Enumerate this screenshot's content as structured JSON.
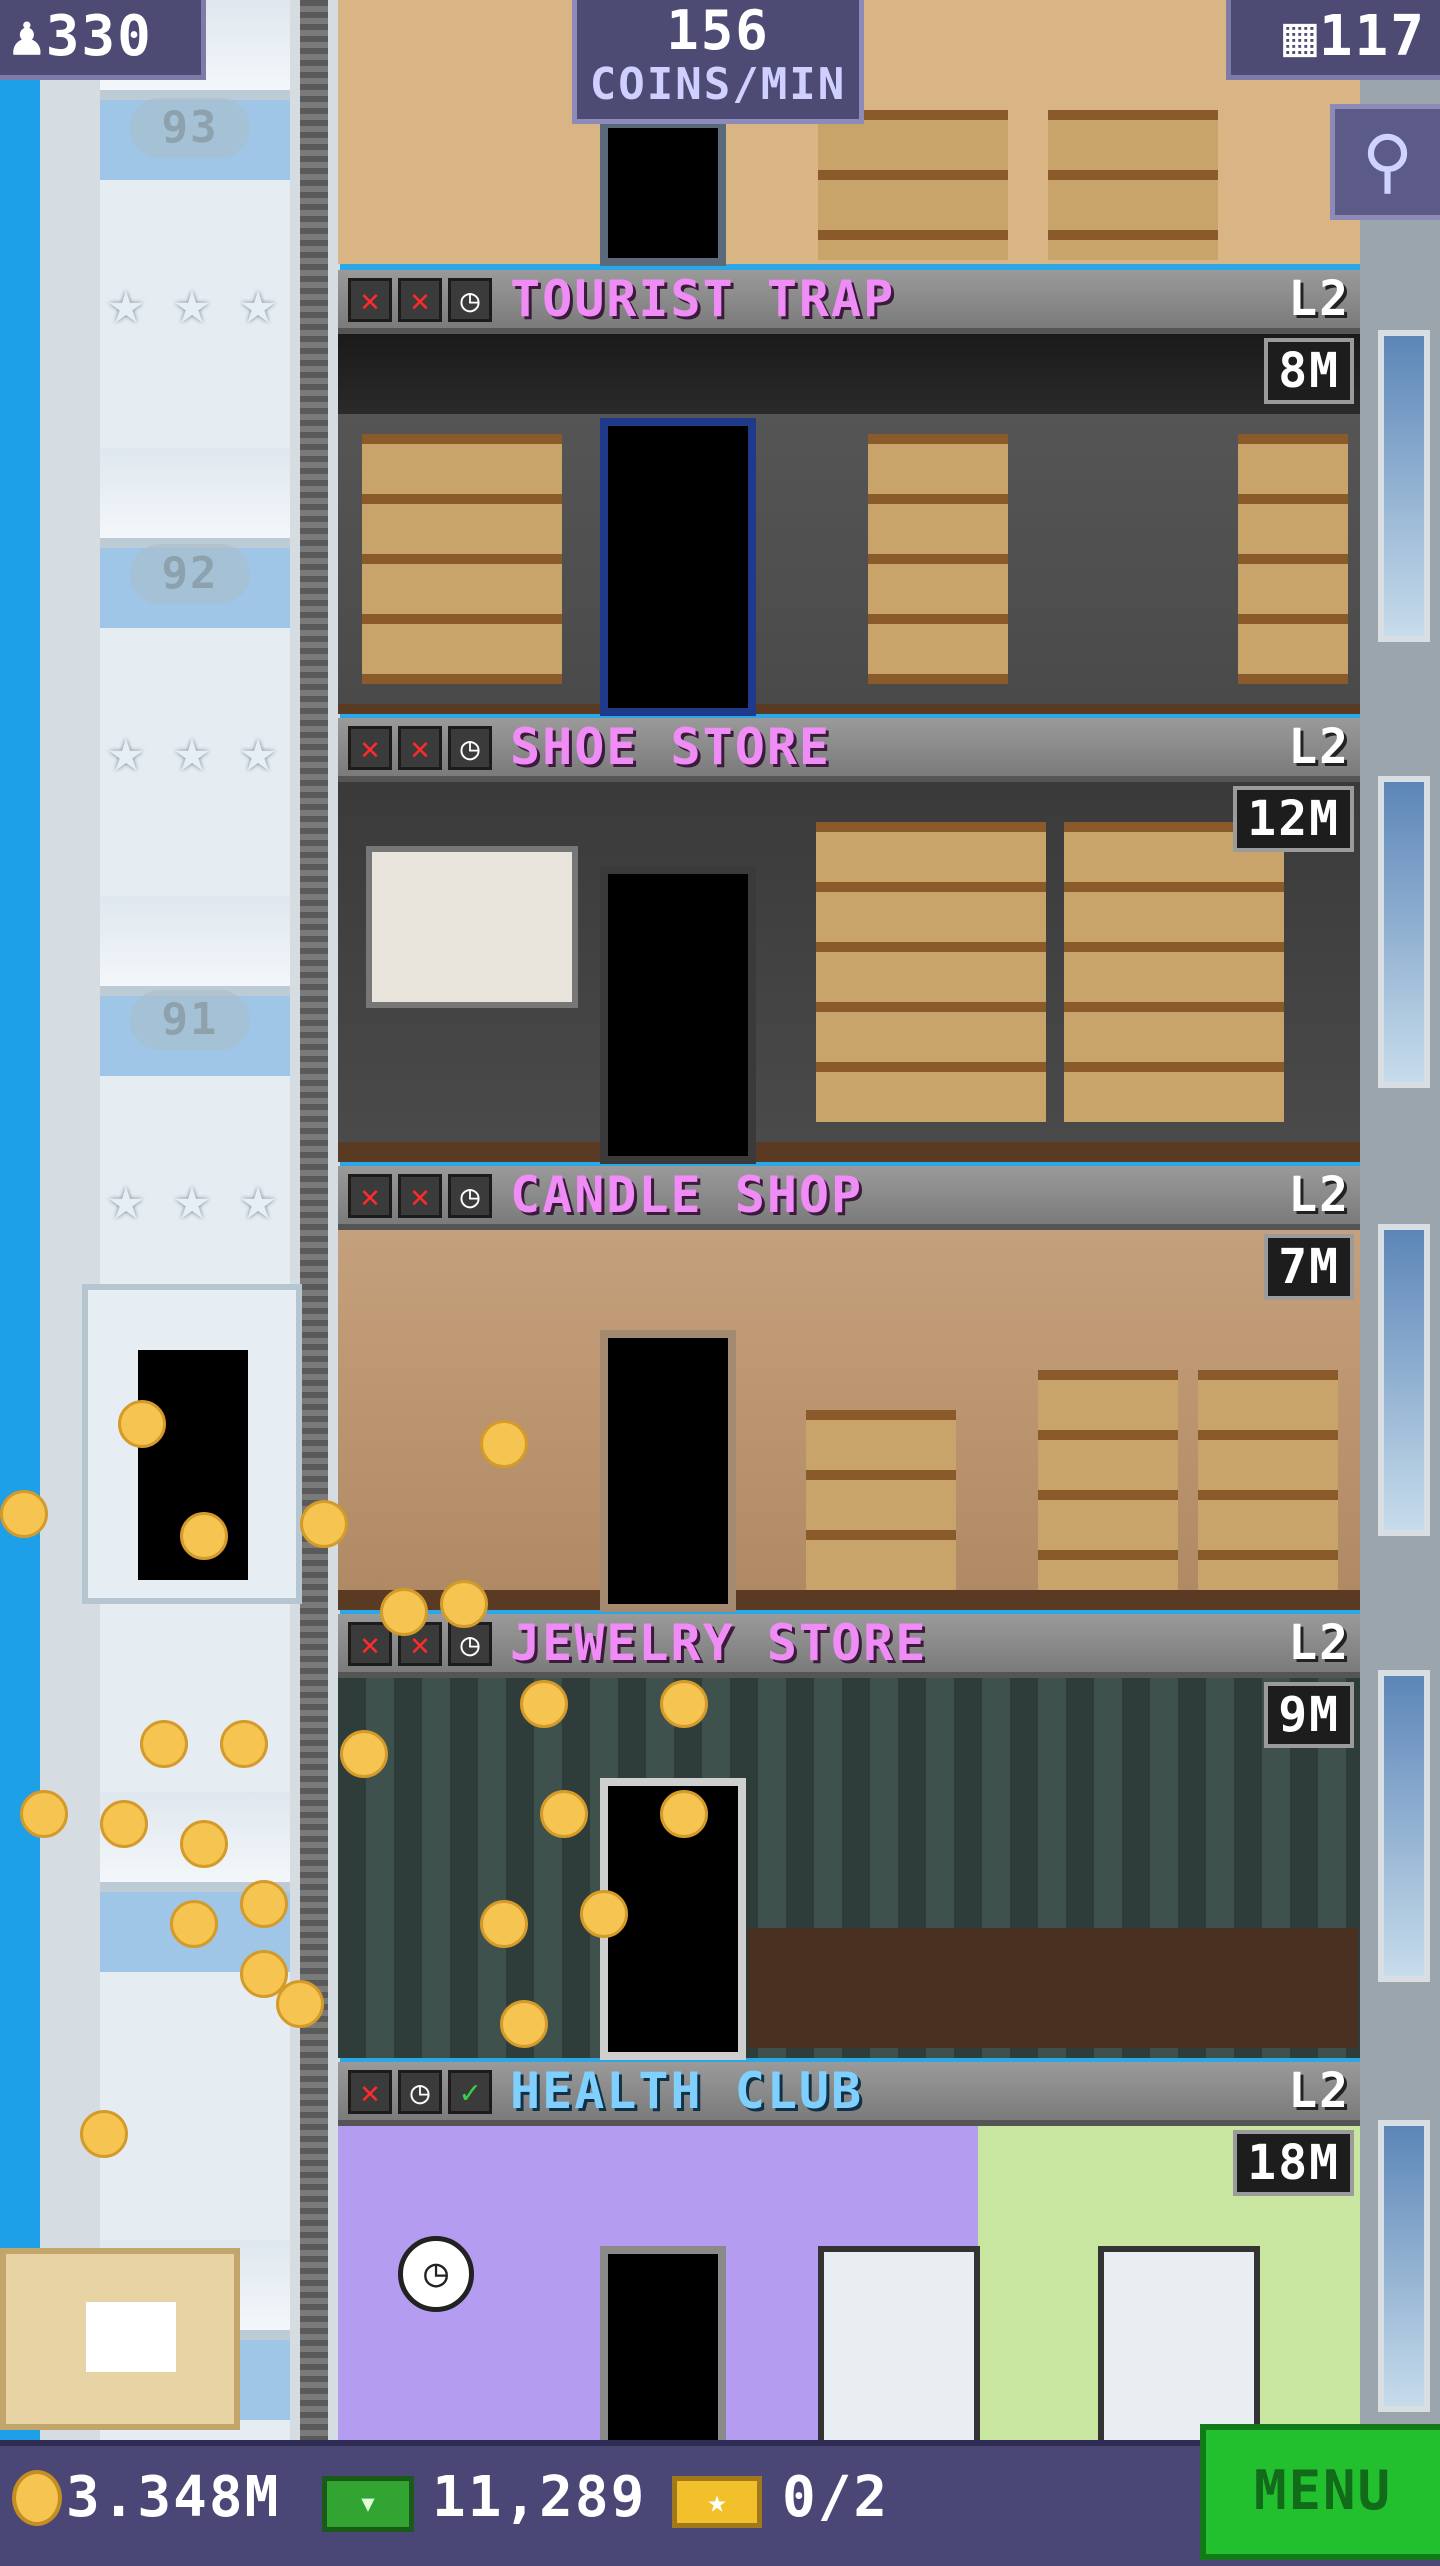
{
  "hud": {
    "population": "330",
    "population_icon": "person-icon",
    "coins_per_min_value": "156",
    "coins_per_min_label": "COINS/MIN",
    "floors_count": "117",
    "floors_icon": "building-icon"
  },
  "elevator": {
    "floor_numbers": [
      "93",
      "92",
      "91"
    ]
  },
  "floors": [
    {
      "name": "TOURIST TRAP",
      "level": "L2",
      "money": "8M",
      "badges": [
        "x",
        "x",
        "clock"
      ],
      "type": "retail"
    },
    {
      "name": "SHOE STORE",
      "level": "L2",
      "money": "12M",
      "badges": [
        "x",
        "x",
        "clock"
      ],
      "type": "retail"
    },
    {
      "name": "CANDLE SHOP",
      "level": "L2",
      "money": "7M",
      "badges": [
        "x",
        "x",
        "clock"
      ],
      "type": "retail"
    },
    {
      "name": "JEWELRY STORE",
      "level": "L2",
      "money": "9M",
      "badges": [
        "x",
        "x",
        "clock"
      ],
      "type": "retail"
    },
    {
      "name": "HEALTH CLUB",
      "level": "L2",
      "money": "18M",
      "badges": [
        "x",
        "clock",
        "check"
      ],
      "type": "service"
    }
  ],
  "bottom_bar": {
    "coins": "3.348M",
    "tower_bux": "11,289",
    "tickets": "0/2",
    "menu_label": "MENU"
  },
  "colors": {
    "retail_name": "#f08cf5",
    "service_name": "#7fd0ff",
    "hud_bg": "#4d4b74",
    "menu_green": "#22c02e"
  }
}
